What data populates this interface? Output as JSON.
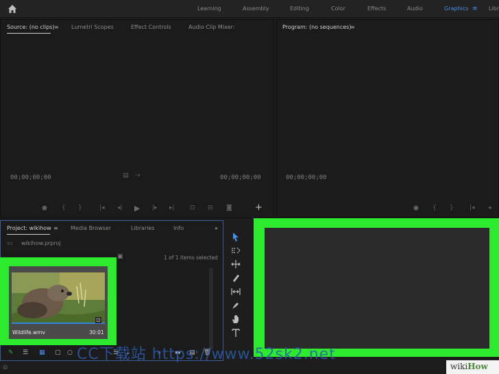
{
  "workspaces": [
    {
      "label": "Learning"
    },
    {
      "label": "Assembly"
    },
    {
      "label": "Editing"
    },
    {
      "label": "Color"
    },
    {
      "label": "Effects"
    },
    {
      "label": "Audio"
    },
    {
      "label": "Graphics"
    },
    {
      "label": "Libr"
    }
  ],
  "source_panel": {
    "tabs": [
      "Source: (no clips)",
      "Lumetri Scopes",
      "Effect Controls",
      "Audio Clip Mixer:"
    ],
    "timecode_left": "00;00;00;00",
    "timecode_right": "00;00;00;00"
  },
  "program_panel": {
    "tab": "Program: (no sequences)",
    "timecode_left": "00;00;00;00"
  },
  "project_panel": {
    "tabs": [
      "Project: wikihow",
      "Media Browser",
      "Libraries",
      "Info"
    ],
    "project_file": "wikihow.prproj",
    "selection_info": "1 of 1 items selected",
    "clip": {
      "name": "Wildlife.wmv",
      "duration": "30:01"
    }
  },
  "watermark": "CC下载站 https://www.52sk2.net",
  "badge": {
    "brand": "wiki",
    "brand_bold": "How"
  },
  "colors": {
    "highlight": "#2eea2e",
    "accent": "#4a8fe8"
  }
}
